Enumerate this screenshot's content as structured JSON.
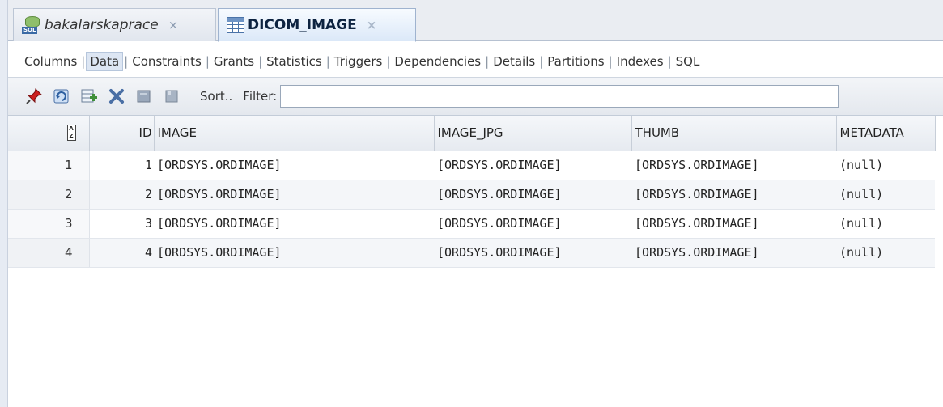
{
  "tabs": [
    {
      "label": "bakalarskaprace",
      "close": "×",
      "icon": "sql-db-icon"
    },
    {
      "label": "DICOM_IMAGE",
      "close": "×",
      "icon": "table-icon"
    }
  ],
  "subtabs": [
    "Columns",
    "Data",
    "Constraints",
    "Grants",
    "Statistics",
    "Triggers",
    "Dependencies",
    "Details",
    "Partitions",
    "Indexes",
    "SQL"
  ],
  "subtabs_active": "Data",
  "toolbar": {
    "icons": [
      "pin-icon",
      "refresh-icon",
      "insert-row-icon",
      "delete-row-icon",
      "commit-icon",
      "rollback-icon"
    ],
    "sort_label": "Sort..",
    "filter_label": "Filter:",
    "filter_value": ""
  },
  "grid": {
    "sort_icon": "sort-az-icon",
    "columns": [
      "ID",
      "IMAGE",
      "IMAGE_JPG",
      "THUMB",
      "METADATA"
    ],
    "rows": [
      {
        "num": "1",
        "ID": "1",
        "IMAGE": "[ORDSYS.ORDIMAGE]",
        "IMAGE_JPG": "[ORDSYS.ORDIMAGE]",
        "THUMB": "[ORDSYS.ORDIMAGE]",
        "METADATA": "(null)"
      },
      {
        "num": "2",
        "ID": "2",
        "IMAGE": "[ORDSYS.ORDIMAGE]",
        "IMAGE_JPG": "[ORDSYS.ORDIMAGE]",
        "THUMB": "[ORDSYS.ORDIMAGE]",
        "METADATA": "(null)"
      },
      {
        "num": "3",
        "ID": "3",
        "IMAGE": "[ORDSYS.ORDIMAGE]",
        "IMAGE_JPG": "[ORDSYS.ORDIMAGE]",
        "THUMB": "[ORDSYS.ORDIMAGE]",
        "METADATA": "(null)"
      },
      {
        "num": "4",
        "ID": "4",
        "IMAGE": "[ORDSYS.ORDIMAGE]",
        "IMAGE_JPG": "[ORDSYS.ORDIMAGE]",
        "THUMB": "[ORDSYS.ORDIMAGE]",
        "METADATA": "(null)"
      }
    ]
  },
  "colors": {
    "active_tab": "#dbe8f8",
    "pin": "#cc1f1f",
    "delete": "#4a6fa5",
    "insert": "#3f8f3a"
  }
}
